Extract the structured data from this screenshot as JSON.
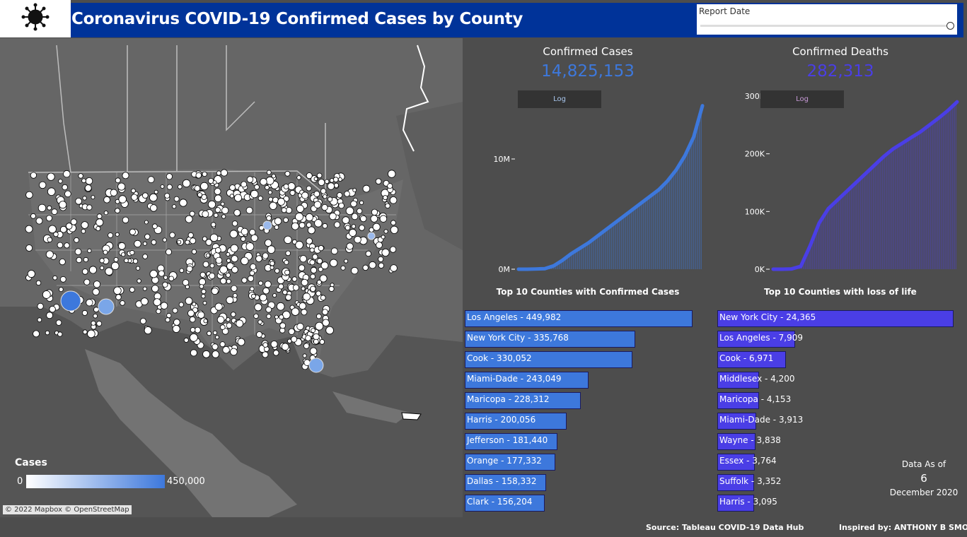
{
  "header": {
    "title": "Coronavirus COVID-19  Confirmed Cases by County",
    "report_date_label": "Report Date"
  },
  "kpis": {
    "cases": {
      "label": "Confirmed Cases",
      "value": "14,825,153",
      "color": "#3d78dc"
    },
    "deaths": {
      "label": "Confirmed Deaths",
      "value": "282,313",
      "color": "#4a3ee6"
    }
  },
  "log_buttons": {
    "cases": "Log",
    "deaths": "Log"
  },
  "chart_data": [
    {
      "type": "area",
      "series": [
        {
          "values": [
            0,
            0,
            0.02,
            0.05,
            0.3,
            0.8,
            1.4,
            1.9,
            2.4,
            3.0,
            3.6,
            4.2,
            4.8,
            5.4,
            6.0,
            6.6,
            7.2,
            8.0,
            9.0,
            10.3,
            12.0,
            14.83
          ]
        }
      ],
      "yticks": [
        "10M",
        "0M"
      ],
      "ylim": [
        0,
        15
      ],
      "color": "#3d78dc"
    },
    {
      "type": "area",
      "series": [
        {
          "values": [
            0,
            0,
            0.5,
            5,
            40,
            80,
            105,
            120,
            135,
            150,
            165,
            180,
            195,
            208,
            218,
            228,
            238,
            250,
            262,
            275,
            290
          ]
        }
      ],
      "yticks": [
        "300K",
        "200K",
        "100K",
        "0K"
      ],
      "ylim": [
        0,
        300
      ],
      "color": "#4a3ee6"
    }
  ],
  "top_cases": {
    "title": "Top 10 Counties with Confirmed Cases",
    "color": "#3d78dc",
    "rows": [
      {
        "label": "Los Angeles - 449,982",
        "value": 449982
      },
      {
        "label": "New York City - 335,768",
        "value": 335768
      },
      {
        "label": "Cook - 330,052",
        "value": 330052
      },
      {
        "label": "Miami-Dade - 243,049",
        "value": 243049
      },
      {
        "label": "Maricopa - 228,312",
        "value": 228312
      },
      {
        "label": "Harris - 200,056",
        "value": 200056
      },
      {
        "label": "Jefferson - 181,440",
        "value": 181440
      },
      {
        "label": "Orange - 177,332",
        "value": 177332
      },
      {
        "label": "Dallas - 158,332",
        "value": 158332
      },
      {
        "label": "Clark - 156,204",
        "value": 156204
      }
    ]
  },
  "top_deaths": {
    "title": "Top 10 Counties with loss of life",
    "color": "#4a3ee6",
    "rows": [
      {
        "label": "New York City - 24,365",
        "value": 24365
      },
      {
        "label": "Los Angeles - 7,909",
        "value": 7909
      },
      {
        "label": "Cook - 6,971",
        "value": 6971
      },
      {
        "label": "Middlesex - 4,200",
        "value": 4200
      },
      {
        "label": "Maricopa - 4,153",
        "value": 4153
      },
      {
        "label": "Miami-Dade - 3,913",
        "value": 3913
      },
      {
        "label": "Wayne - 3,838",
        "value": 3838
      },
      {
        "label": "Essex - 3,764",
        "value": 3764
      },
      {
        "label": "Suffolk - 3,352",
        "value": 3352
      },
      {
        "label": "Harris - 3,095",
        "value": 3095
      }
    ]
  },
  "legend": {
    "title": "Cases",
    "min": "0",
    "max": "450,000"
  },
  "attribution": "© 2022 Mapbox  © OpenStreetMap",
  "data_as_of": {
    "label": "Data As of",
    "day": "6",
    "month_year": "December 2020"
  },
  "footer": {
    "source": "Source: Tableau COVID-19 Data Hub",
    "inspired": "Inspired by: ANTHONY B SMOAK"
  },
  "icons": {
    "logo": "coronavirus-icon"
  }
}
